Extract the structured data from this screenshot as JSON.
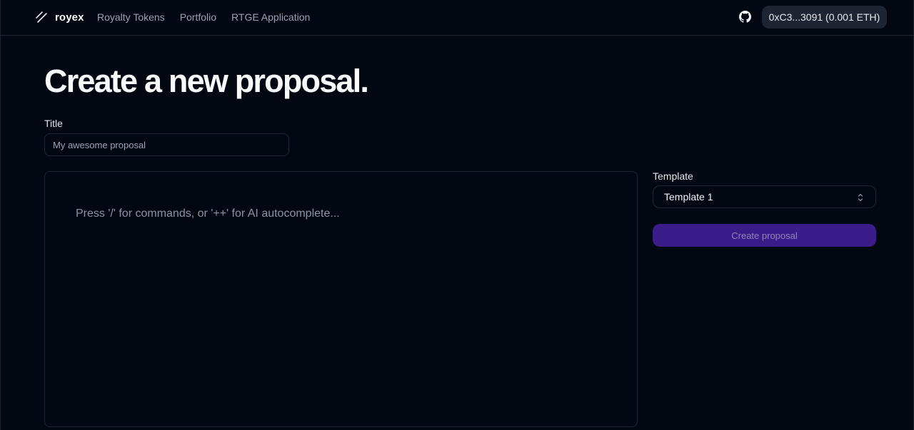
{
  "header": {
    "brand": {
      "name": "royex",
      "icon": "slash-lines-icon"
    },
    "nav": [
      {
        "label": "Royalty Tokens"
      },
      {
        "label": "Portfolio"
      },
      {
        "label": "RTGE Application"
      }
    ],
    "github_icon": "github-icon",
    "wallet_label": "0xC3...3091 (0.001 ETH)"
  },
  "main": {
    "page_title": "Create a new proposal.",
    "title_field": {
      "label": "Title",
      "placeholder": "My awesome proposal",
      "value": ""
    },
    "editor": {
      "placeholder": "Press '/' for commands, or '++' for AI autocomplete..."
    },
    "template": {
      "label": "Template",
      "selected": "Template 1",
      "icon": "chevron-up-down-icon"
    },
    "create_button_label": "Create proposal"
  },
  "colors": {
    "background": "#030711",
    "border": "#1e2532",
    "wallet_bg": "#1e2532",
    "create_button_bg": "#3b1d8a",
    "muted_text": "#9aa3b2"
  }
}
